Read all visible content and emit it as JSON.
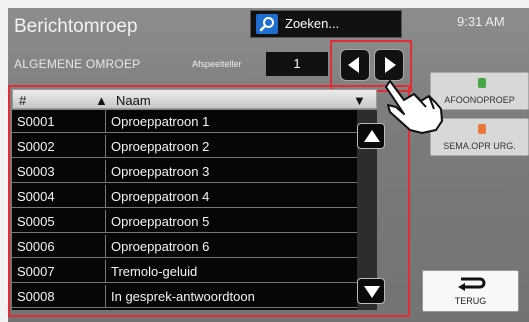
{
  "header": {
    "title": "Berichtomroep",
    "search_label": "Zoeken...",
    "time": "9:31 AM"
  },
  "toolbar": {
    "section_label": "ALGEMENE OMROEP",
    "counter_label": "Afspeelteller",
    "counter_value": "1"
  },
  "table": {
    "columns": [
      "#",
      "Naam"
    ],
    "rows": [
      {
        "num": "S0001",
        "name": "Oproeppatroon 1"
      },
      {
        "num": "S0002",
        "name": "Oproeppatroon 2"
      },
      {
        "num": "S0003",
        "name": "Oproeppatroon 3"
      },
      {
        "num": "S0004",
        "name": "Oproeppatroon 4"
      },
      {
        "num": "S0005",
        "name": "Oproeppatroon 5"
      },
      {
        "num": "S0006",
        "name": "Oproeppatroon 6"
      },
      {
        "num": "S0007",
        "name": "Tremolo-geluid"
      },
      {
        "num": "S0008",
        "name": "In gesprek-antwoordtoon"
      }
    ]
  },
  "side": {
    "button1": "AFOONOPROEP",
    "button2": "SEMA.OPR URG.",
    "back": "TERUG"
  },
  "icons": {
    "search": "search-icon",
    "left": "arrow-left-icon",
    "right": "arrow-right-icon",
    "up": "scroll-up-icon",
    "down": "scroll-down-icon",
    "hand": "pointing-hand-icon"
  }
}
